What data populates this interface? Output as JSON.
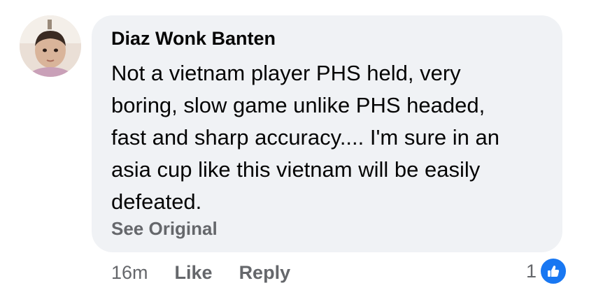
{
  "comment": {
    "author": "Diaz Wonk Banten",
    "text_lines": [
      "Not a vietnam player PHS held, very",
      "boring, slow game unlike PHS headed,",
      "fast and sharp accuracy.... I'm sure in an",
      "asia cup like this vietnam will be easily",
      "defeated."
    ],
    "see_original_label": "See Original"
  },
  "actions": {
    "timestamp": "16m",
    "like_label": "Like",
    "reply_label": "Reply"
  },
  "reactions": {
    "count": "1",
    "icon": "thumbs-up-icon"
  },
  "colors": {
    "bubble_bg": "#f0f2f5",
    "secondary_text": "#65676b",
    "like_blue": "#1877f2"
  }
}
